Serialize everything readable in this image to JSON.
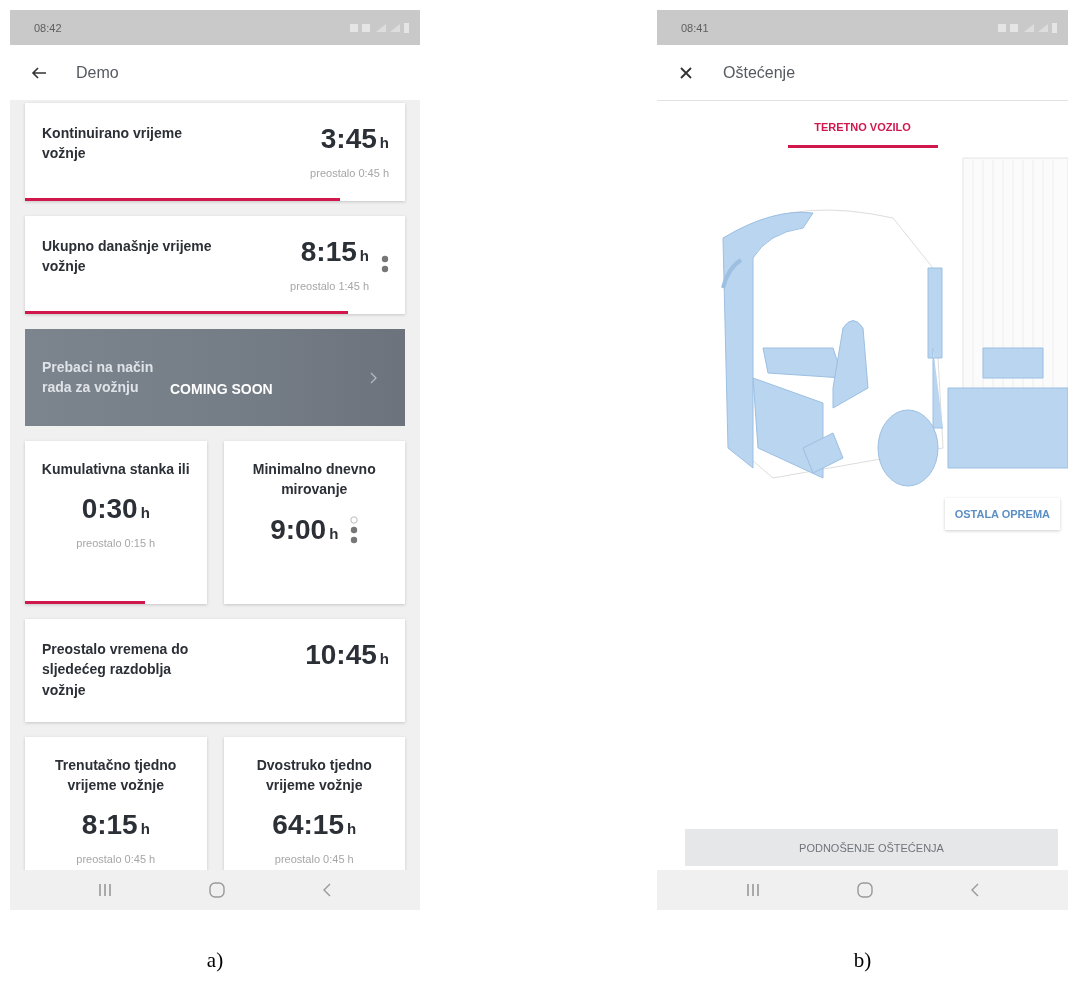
{
  "screen_a": {
    "status_time": "08:42",
    "title": "Demo",
    "rows": [
      {
        "cards": [
          {
            "kind": "wide",
            "label": "Kontinuirano vrijeme vožnje",
            "value": "3:45",
            "unit": "h",
            "remaining": "preostalo 0:45 h",
            "level": 0.83
          }
        ]
      },
      {
        "cards": [
          {
            "kind": "wide",
            "label": "Ukupno današnje vrijeme vožnje",
            "value": "8:15",
            "unit": "h",
            "remaining": "preostalo 1:45 h",
            "level": 0.85,
            "pager": [
              {
                "selected": true
              },
              {
                "selected": true
              }
            ]
          }
        ]
      },
      {
        "cards": [
          {
            "kind": "banner",
            "label": "Prebaci na način rada za vožnju",
            "badge": "COMING SOON"
          }
        ]
      },
      {
        "cards": [
          {
            "kind": "tile",
            "label": "Kumulativna stanka ili",
            "value": "0:30",
            "unit": "h",
            "remaining": "preostalo 0:15 h",
            "level": 0.66
          },
          {
            "kind": "tile",
            "label": "Minimalno dnevno mirovanje",
            "value": "9:00",
            "unit": "h",
            "pager": [
              {
                "selected": false
              },
              {
                "selected": true
              },
              {
                "selected": true
              }
            ]
          }
        ]
      },
      {
        "cards": [
          {
            "kind": "wide",
            "label": "Preostalo vremena do sljedećeg razdoblja vožnje",
            "value": "10:45",
            "unit": "h"
          }
        ]
      },
      {
        "cards": [
          {
            "kind": "tile",
            "label": "Trenutačno tjedno vrijeme vožnje",
            "value": "8:15",
            "unit": "h",
            "remaining": "preostalo 0:45 h"
          },
          {
            "kind": "tile",
            "label": "Dvostruko tjedno vrijeme vožnje",
            "value": "64:15",
            "unit": "h",
            "remaining": "preostalo 0:45 h"
          }
        ]
      }
    ]
  },
  "screen_b": {
    "status_time": "08:41",
    "title": "Oštećenje",
    "tabs": [
      {
        "label": "TERETNO VOZILO",
        "selected": true
      }
    ],
    "equipment_button": "OSTALA OPREMA",
    "submit_button": "PODNOŠENJE OŠTEĆENJA"
  },
  "captions": [
    "a)",
    "b)"
  ]
}
